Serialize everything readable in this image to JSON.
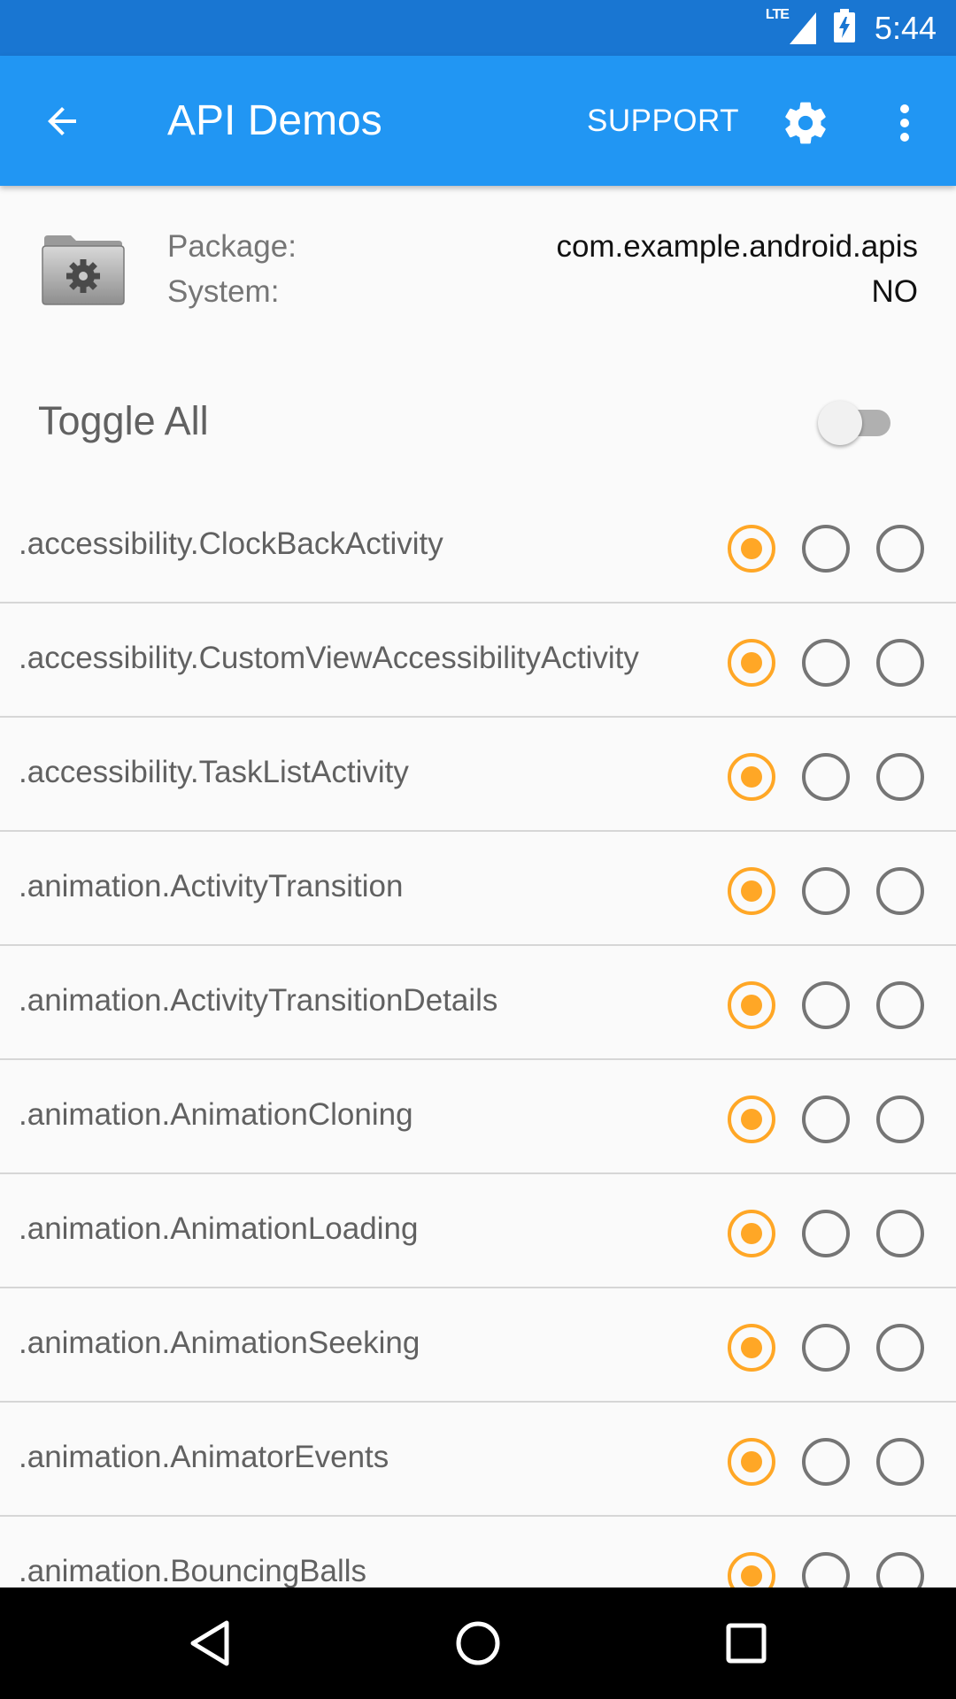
{
  "status_bar": {
    "network": "LTE",
    "time": "5:44"
  },
  "app_bar": {
    "title": "API Demos",
    "support_label": "SUPPORT"
  },
  "package_info": {
    "package_label": "Package:",
    "package_value": "com.example.android.apis",
    "system_label": "System:",
    "system_value": "NO"
  },
  "toggle_all": {
    "label": "Toggle All",
    "on": false
  },
  "activities": [
    {
      "name": ".accessibility.ClockBackActivity",
      "selected": 0
    },
    {
      "name": ".accessibility.CustomViewAccessibilityActivity",
      "selected": 0
    },
    {
      "name": ".accessibility.TaskListActivity",
      "selected": 0
    },
    {
      "name": ".animation.ActivityTransition",
      "selected": 0
    },
    {
      "name": ".animation.ActivityTransitionDetails",
      "selected": 0
    },
    {
      "name": ".animation.AnimationCloning",
      "selected": 0
    },
    {
      "name": ".animation.AnimationLoading",
      "selected": 0
    },
    {
      "name": ".animation.AnimationSeeking",
      "selected": 0
    },
    {
      "name": ".animation.AnimatorEvents",
      "selected": 0
    },
    {
      "name": ".animation.BouncingBalls",
      "selected": 0
    }
  ],
  "colors": {
    "status_bar": "#1976d2",
    "app_bar": "#2196f3",
    "radio_selected": "#ffa726",
    "radio_unselected": "#757575"
  },
  "icons": {
    "back": "arrow-left-icon",
    "settings": "gear-icon",
    "more": "more-vert-icon",
    "package": "folder-gear-icon"
  }
}
